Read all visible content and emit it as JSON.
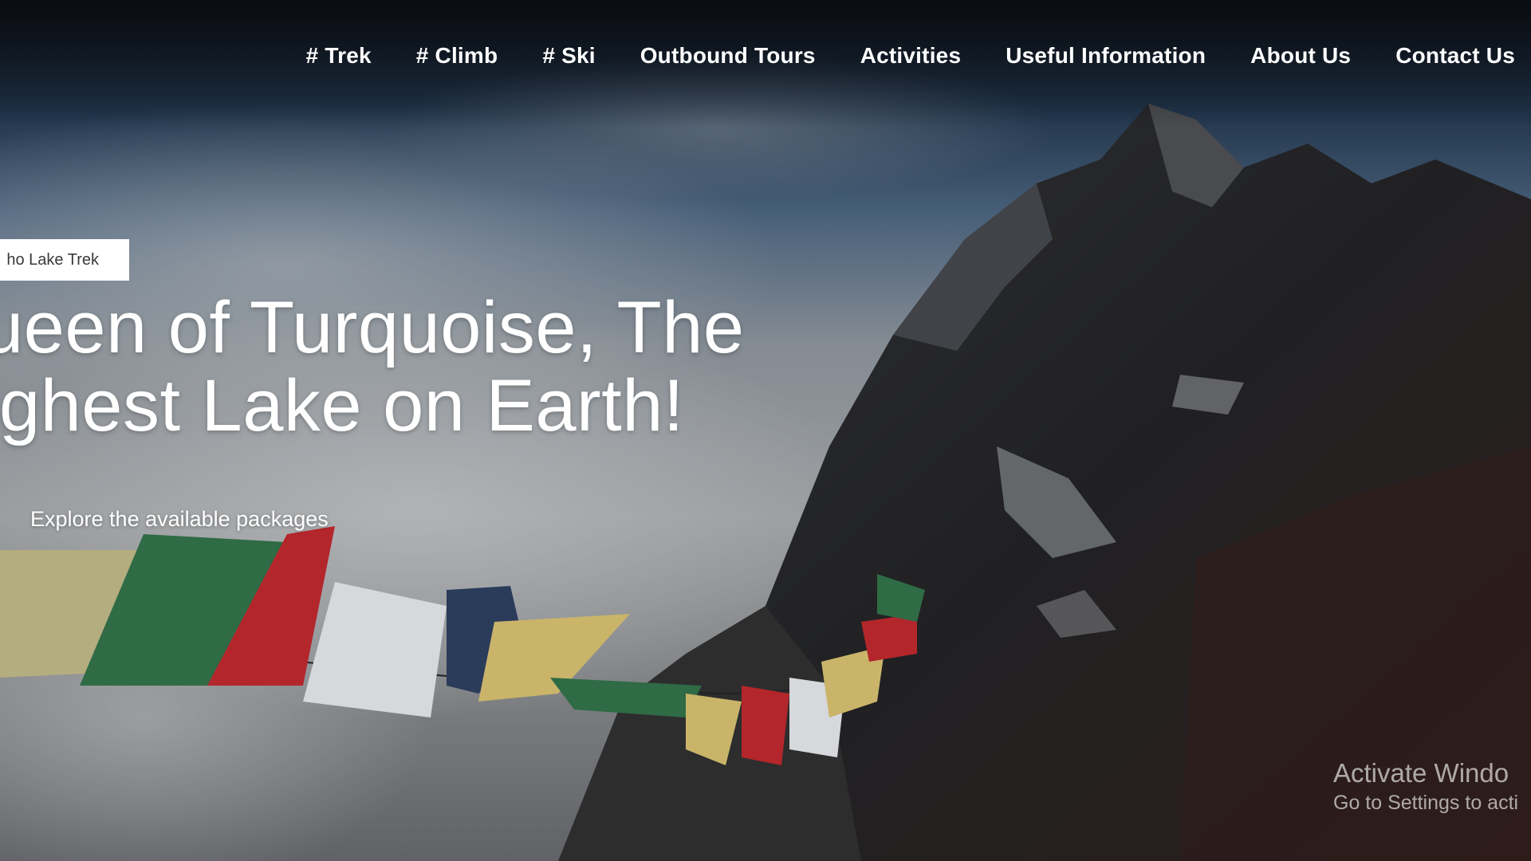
{
  "nav": {
    "items": [
      {
        "label": "# Trek"
      },
      {
        "label": "# Climb"
      },
      {
        "label": "# Ski"
      },
      {
        "label": "Outbound Tours"
      },
      {
        "label": "Activities"
      },
      {
        "label": "Useful Information"
      },
      {
        "label": "About Us"
      },
      {
        "label": "Contact Us"
      }
    ]
  },
  "hero": {
    "tag": "ho Lake Trek",
    "headline_line1": "ueen of Turquoise, The",
    "headline_line2": "ighest Lake on Earth!",
    "cta": "Explore the available packages"
  },
  "os_watermark": {
    "title": "Activate Windo",
    "subtitle": "Go to Settings to acti"
  },
  "colors": {
    "nav_text": "#ffffff",
    "tag_bg": "#ffffff",
    "flag_green": "#2f6b45",
    "flag_red": "#b3262b",
    "flag_yellow": "#c9b46a",
    "flag_blue": "#2b3b5a",
    "flag_white": "#d6d8dc"
  }
}
